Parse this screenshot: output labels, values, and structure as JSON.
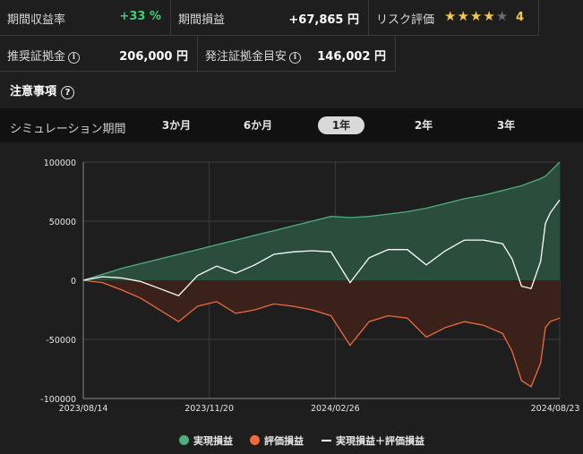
{
  "stats": {
    "return_rate_label": "期間収益率",
    "return_rate_value": "+33 %",
    "period_pl_label": "期間損益",
    "period_pl_value": "+67,865 円",
    "risk_label": "リスク評価",
    "risk_value": "4",
    "risk_stars": 4,
    "risk_stars_max": 5,
    "margin_label": "推奨証拠金",
    "margin_value": "206,000 円",
    "order_margin_label": "発注証拠金目安",
    "order_margin_value": "146,002 円"
  },
  "notes": {
    "label": "注意事項"
  },
  "simulation": {
    "label": "シミュレーション期間",
    "tabs": [
      "3か月",
      "6か月",
      "1年",
      "2年",
      "3年"
    ],
    "active_index": 2
  },
  "legend": {
    "realized": "実現損益",
    "unrealized": "評価損益",
    "total": "実現損益＋評価損益"
  },
  "colors": {
    "realized": "#4caf7d",
    "realized_fill": "#2b4d3c",
    "unrealized": "#f06a3c",
    "unrealized_fill": "#3a211a",
    "total": "#ffffff",
    "positive_text": "#3dcf74",
    "star": "#f2c94c"
  },
  "chart_data": {
    "type": "area",
    "x_ticks": [
      "2023/08/14",
      "2023/11/20",
      "2024/02/26",
      "2024/08/23"
    ],
    "x_tick_positions": [
      0,
      0.2644,
      0.5288,
      1.0
    ],
    "y_ticks": [
      100000,
      50000,
      0,
      -50000,
      -100000
    ],
    "ylim": [
      -100000,
      100000
    ],
    "grid": true,
    "x": [
      0,
      0.04,
      0.08,
      0.12,
      0.16,
      0.2,
      0.24,
      0.28,
      0.32,
      0.36,
      0.4,
      0.44,
      0.48,
      0.52,
      0.56,
      0.6,
      0.64,
      0.68,
      0.72,
      0.76,
      0.8,
      0.84,
      0.88,
      0.9,
      0.92,
      0.94,
      0.96,
      0.97,
      0.98,
      1.0
    ],
    "series": [
      {
        "name": "実現損益",
        "values": [
          0,
          5000,
          10000,
          14000,
          18000,
          22000,
          26000,
          30000,
          34000,
          38000,
          42000,
          46000,
          50000,
          54000,
          53000,
          54000,
          56000,
          58000,
          61000,
          65000,
          69000,
          72000,
          76000,
          78000,
          80000,
          83000,
          86000,
          88000,
          92000,
          100000
        ]
      },
      {
        "name": "評価損益",
        "values": [
          0,
          -2000,
          -8000,
          -15000,
          -25000,
          -35000,
          -22000,
          -18000,
          -28000,
          -25000,
          -20000,
          -22000,
          -25000,
          -30000,
          -55000,
          -35000,
          -30000,
          -32000,
          -48000,
          -40000,
          -35000,
          -38000,
          -45000,
          -60000,
          -85000,
          -90000,
          -70000,
          -40000,
          -35000,
          -32000
        ]
      },
      {
        "name": "実現損益＋評価損益",
        "values": [
          0,
          3000,
          2000,
          -1000,
          -7000,
          -13000,
          4000,
          12000,
          6000,
          13000,
          22000,
          24000,
          25000,
          24000,
          -2000,
          19000,
          26000,
          26000,
          13000,
          25000,
          34000,
          34000,
          31000,
          18000,
          -5000,
          -7000,
          16000,
          48000,
          57000,
          68000
        ]
      }
    ]
  }
}
